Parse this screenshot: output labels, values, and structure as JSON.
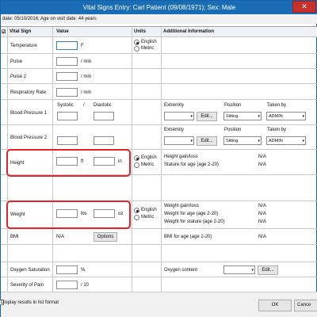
{
  "window": {
    "title": "Vital Signs Entry: Carl Patient (09/08/1971); Sex: Male",
    "close_label": "✕"
  },
  "visit_info": "date: 05/10/2016; Age on visit date: 44 years",
  "header": {
    "vital_sign": "Vital Sign",
    "value": "Value",
    "units": "Units",
    "additional": "Additional Information"
  },
  "units": {
    "english": "English",
    "metric": "Metric"
  },
  "rows": {
    "temperature": {
      "label": "Temperature",
      "unit": "F"
    },
    "pulse": {
      "label": "Pulse",
      "unit": "/ min"
    },
    "pulse2": {
      "label": "Pulse 2",
      "unit": "/ min"
    },
    "respiratory": {
      "label": "Respiratory Rate",
      "unit": "/ min"
    },
    "bp1": {
      "label": "Blood Pressure 1",
      "systolic": "Systolic",
      "slash": "/",
      "diastolic": "Diastolic"
    },
    "bp2": {
      "label": "Blood Pressure 2"
    },
    "height": {
      "label": "Height",
      "unit_ft": "ft",
      "unit_in": "in"
    },
    "weight": {
      "label": "Weight",
      "unit_lbs": "lbs",
      "unit_oz": "oz"
    },
    "bmi": {
      "label": "BMI",
      "value": "N/A",
      "options": "Options"
    },
    "oxygen": {
      "label": "Oxygen Saturation",
      "unit": "%"
    },
    "pain": {
      "label": "Severity of Pain",
      "unit": "/ 10"
    }
  },
  "bp_extra": {
    "extremity": "Extremity",
    "position": "Position",
    "taken_by": "Taken by",
    "edit": "Edit...",
    "position_value": "Sitting",
    "taken_by_value": "ADMIN"
  },
  "height_info": {
    "gain_loss": "Height gain/loss",
    "gain_loss_value": "N/A",
    "stature": "Stature for age (age 2-20)",
    "stature_value": "N/A"
  },
  "weight_info": {
    "gain_loss": "Weight gain/loss",
    "gain_loss_value": "N/A",
    "for_age": "Weight for age (age 2-20)",
    "for_age_value": "N/A",
    "for_stature": "Weight for stature (age 2-20)",
    "for_stature_value": "N/A"
  },
  "bmi_info": {
    "label": "BMI for age (age 2-20)",
    "value": "N/A"
  },
  "oxygen_info": {
    "label": "Oxygen content",
    "edit": "Edit..."
  },
  "footer": {
    "list_format": "Display results in list format",
    "ok": "OK",
    "cancel": "Cance"
  },
  "colors": {
    "titlebar": "#1a6db5",
    "highlight": "#e4222a",
    "close": "#c9302c"
  }
}
